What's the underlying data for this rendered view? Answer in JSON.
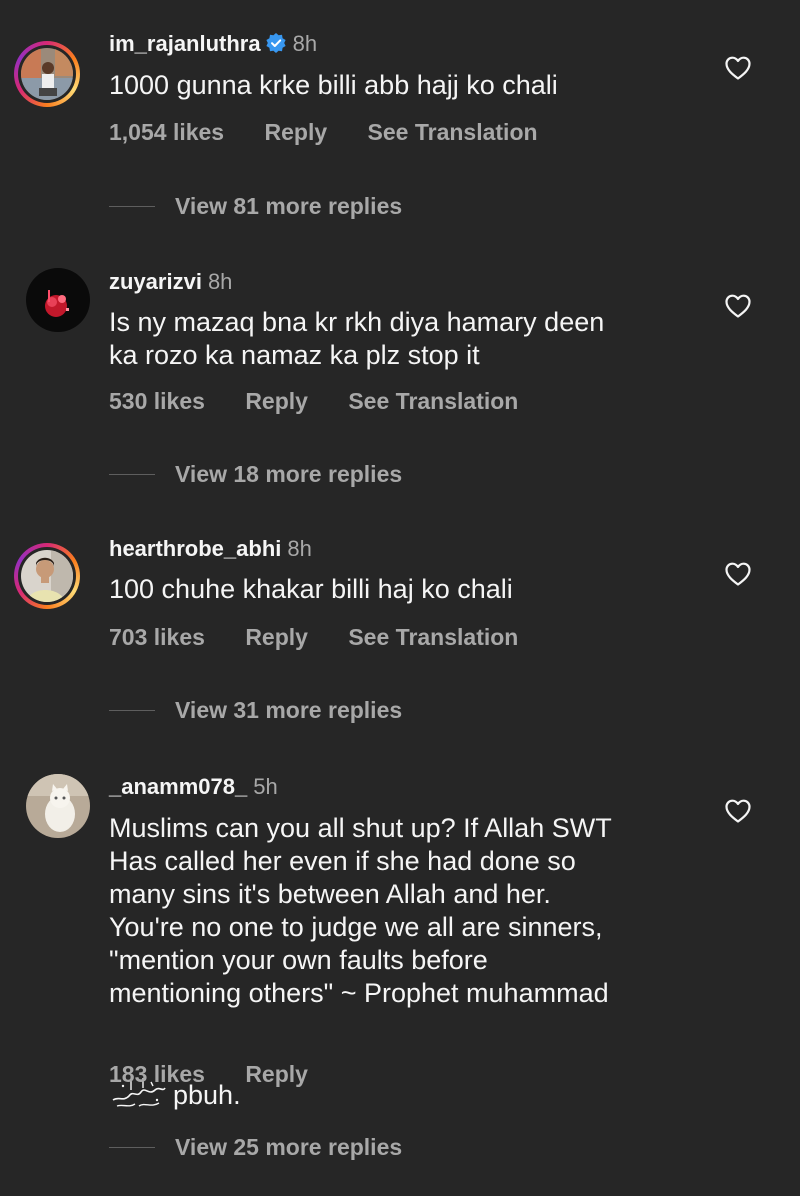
{
  "comments": [
    {
      "username": "im_rajanluthra",
      "verified": true,
      "time": "8h",
      "text": "1000 gunna krke billi abb hajj ko chali",
      "likes": "1,054 likes",
      "reply_label": "Reply",
      "translate_label": "See Translation",
      "view_replies": "View 81 more replies"
    },
    {
      "username": "zuyarizvi",
      "verified": false,
      "time": "8h",
      "text": "Is ny mazaq bna kr rkh diya hamary deen\nka rozo ka namaz ka plz stop it",
      "likes": "530 likes",
      "reply_label": "Reply",
      "translate_label": "See Translation",
      "view_replies": "View 18 more replies"
    },
    {
      "username": "hearthrobe_abhi",
      "verified": false,
      "time": "8h",
      "text": "100 chuhe khakar billi haj ko chali",
      "likes": "703 likes",
      "reply_label": "Reply",
      "translate_label": "See Translation",
      "view_replies": "View 31 more replies"
    },
    {
      "username": "_anamm078_",
      "verified": false,
      "time": "5h",
      "text": "Muslims can you all shut up? If Allah SWT\nHas called her even if she had done so\nmany sins it's between Allah and her.\nYou're no one to judge we all are sinners,\n\"mention your own faults before\nmentioning others\" ~ Prophet muhammad",
      "text_last_line": "pbuh.",
      "calligraphy_text": "صلى الله عليه وسلم",
      "likes": "183 likes",
      "reply_label": "Reply",
      "view_replies": "View 25 more replies"
    }
  ],
  "icons": {
    "heart": "heart-outline-icon",
    "verified": "verified-badge-icon"
  },
  "colors": {
    "background": "#262626",
    "primary_text": "#f5f5f5",
    "secondary_text": "#a8a8a8",
    "verified_blue": "#3897f0"
  }
}
